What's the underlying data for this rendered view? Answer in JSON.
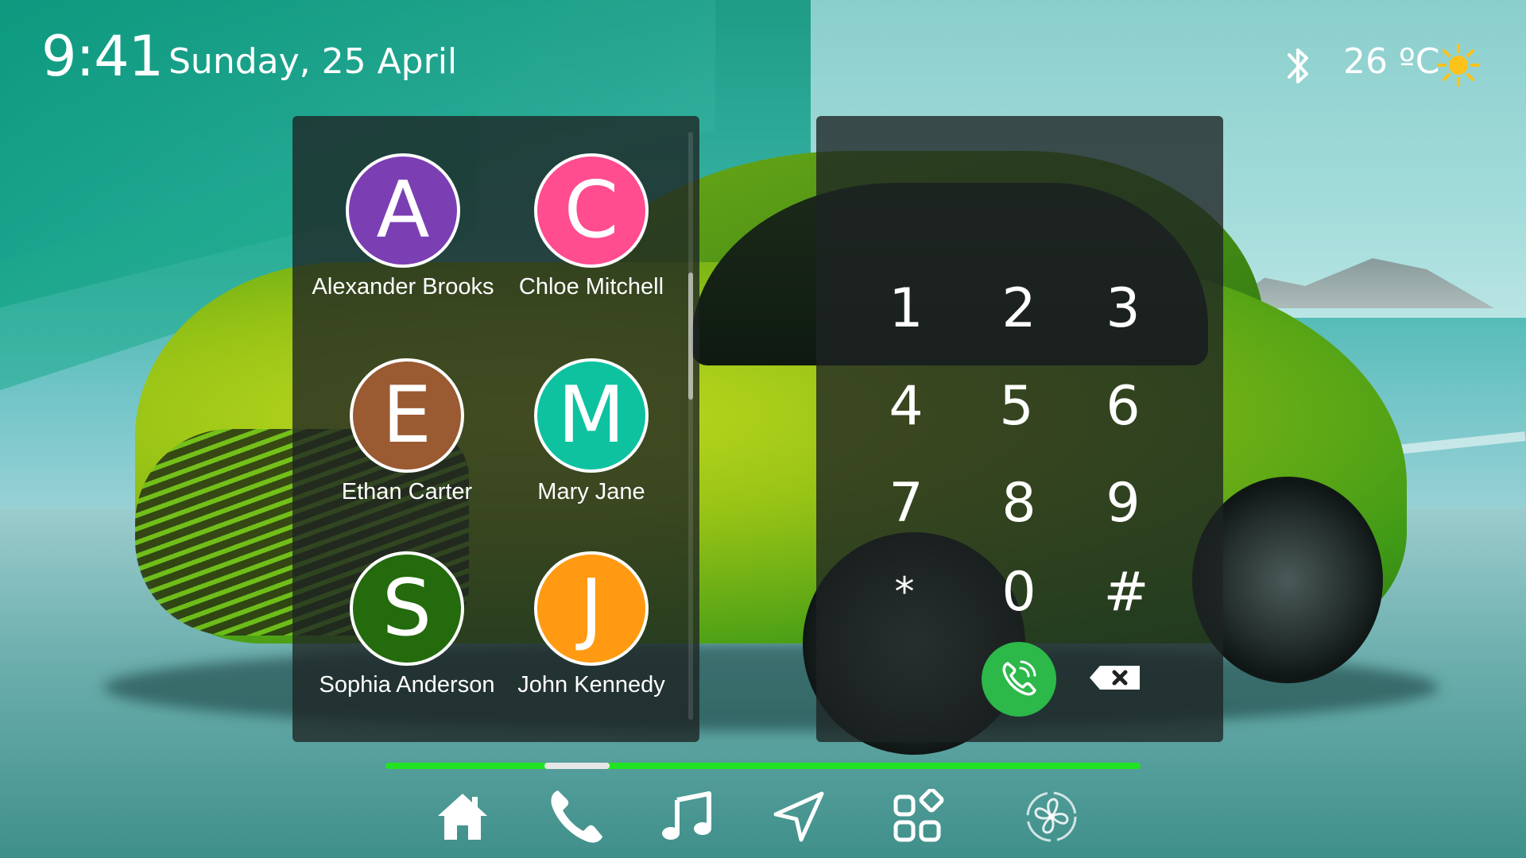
{
  "status": {
    "time": "9:41",
    "date": "Sunday, 25 April",
    "temperature": "26 ºC",
    "bluetooth_icon": "bluetooth-icon",
    "weather_icon": "sun-icon"
  },
  "contacts": [
    {
      "initial": "A",
      "name": "Alexander Brooks",
      "color": "#7b3fb3"
    },
    {
      "initial": "C",
      "name": "Chloe Mitchell",
      "color": "#ff4d8f"
    },
    {
      "initial": "E",
      "name": "Ethan Carter",
      "color": "#9a5a32"
    },
    {
      "initial": "M",
      "name": "Mary Jane",
      "color": "#0ec2a0"
    },
    {
      "initial": "S",
      "name": "Sophia Anderson",
      "color": "#236b0c"
    },
    {
      "initial": "J",
      "name": "John Kennedy",
      "color": "#ff9a12"
    }
  ],
  "dialer": {
    "keys": [
      "1",
      "2",
      "3",
      "4",
      "5",
      "6",
      "7",
      "8",
      "9",
      "*",
      "0",
      "#"
    ],
    "call_icon": "phone-call-icon",
    "backspace_icon": "backspace-icon",
    "call_color": "#2db84a"
  },
  "pager": {
    "active_index": 1,
    "color": "#22e322"
  },
  "dock": [
    {
      "icon": "home-icon"
    },
    {
      "icon": "phone-icon",
      "active": true
    },
    {
      "icon": "music-icon"
    },
    {
      "icon": "navigation-icon"
    },
    {
      "icon": "apps-icon"
    },
    {
      "icon": "fan-icon"
    }
  ]
}
